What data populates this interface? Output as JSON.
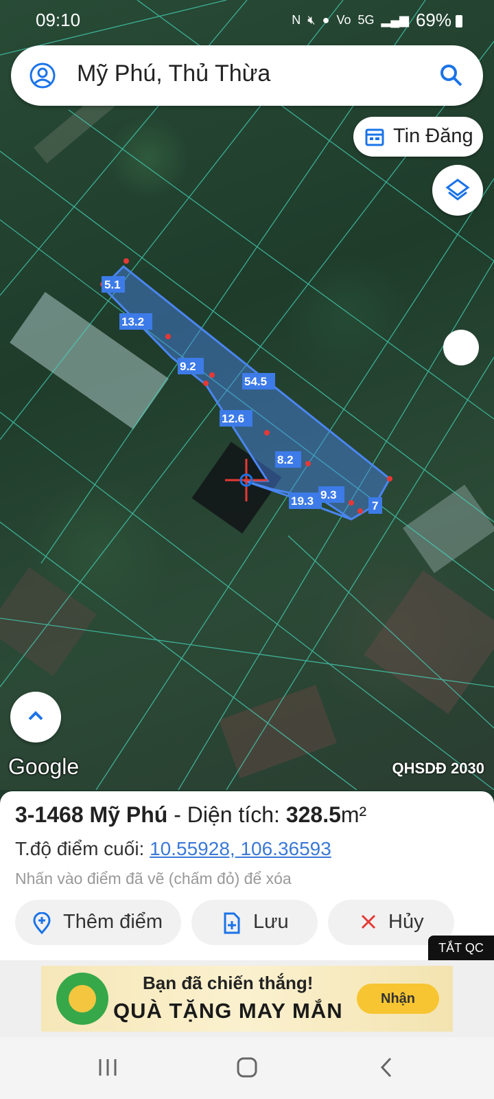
{
  "status_bar": {
    "time": "09:10",
    "battery": "69%",
    "network": "5G",
    "icons": [
      "nfc-icon",
      "mute-icon",
      "location-icon",
      "volte-icon",
      "5g-icon",
      "signal-icon",
      "battery-icon"
    ]
  },
  "search": {
    "query": "Mỹ Phú, Thủ Thừa"
  },
  "tin_dang": {
    "label": "Tin Đăng"
  },
  "map": {
    "brand": "Google",
    "layer_label": "QHSDĐ 2030",
    "measurements": [
      "5.1",
      "13.2",
      "9.2",
      "54.5",
      "12.6",
      "8.2",
      "19.3",
      "9.3",
      "7"
    ]
  },
  "parcel": {
    "name": "3-1468 Mỹ Phú",
    "area_label": "- Diện tích:",
    "area_value": "328.5",
    "area_unit": "m²",
    "coords_label": "T.độ điểm cuối:",
    "coords": "10.55928, 106.36593",
    "hint": "Nhấn vào điểm đã vẽ (chấm đỏ) để xóa"
  },
  "actions": {
    "add_point": "Thêm điểm",
    "save": "Lưu",
    "cancel": "Hủy"
  },
  "ad": {
    "close_label": "TẮT QC",
    "line1": "Bạn đã chiến thắng!",
    "line2": "QUÀ TẶNG MAY MẮN",
    "button": "Nhận"
  },
  "colors": {
    "accent": "#1a73e8",
    "polygon": "#4a86f0",
    "cancel": "#e53935"
  }
}
